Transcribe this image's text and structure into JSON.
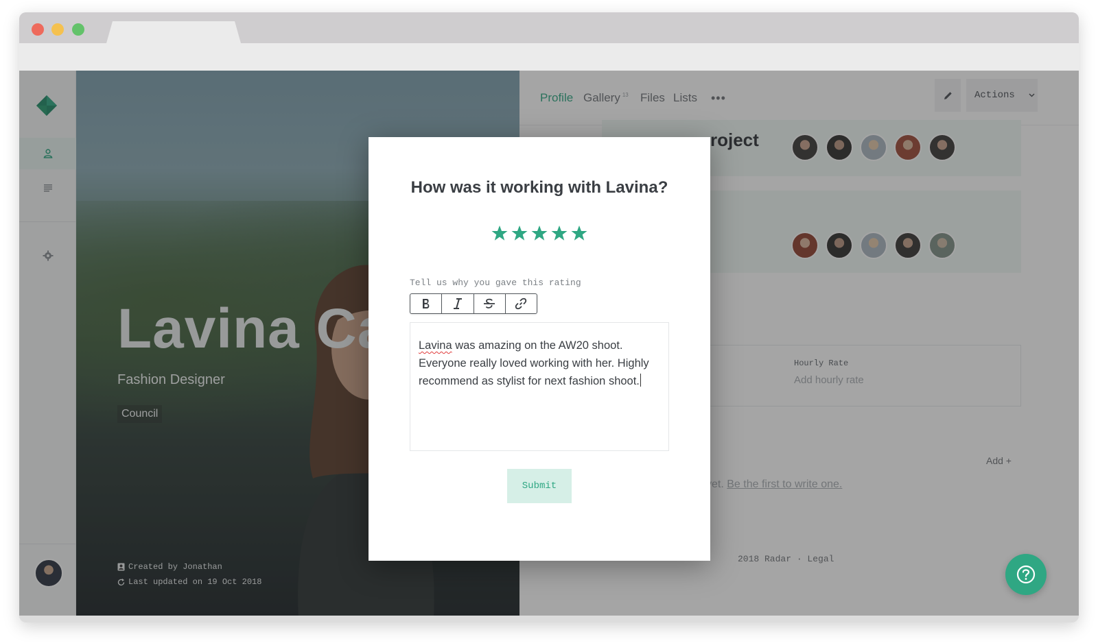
{
  "browser": {
    "window_controls": [
      "close",
      "minimize",
      "maximize"
    ],
    "tab_title": ""
  },
  "sidebar": {
    "logo_icon": "diamond-logo-icon",
    "items": [
      {
        "icon": "person-icon",
        "active": true
      },
      {
        "icon": "list-icon",
        "active": false
      },
      {
        "icon": "gear-icon",
        "active": false
      }
    ]
  },
  "hero": {
    "name": "Lavina Ca",
    "title": "Fashion Designer",
    "tag": "Council",
    "created_by": "Created by Jonathan",
    "last_updated": "Last updated on 19 Oct 2018"
  },
  "topnav": {
    "tabs": [
      {
        "label": "Profile",
        "active": true
      },
      {
        "label": "Gallery",
        "badge": "13",
        "active": false
      },
      {
        "label": "Files",
        "active": false
      },
      {
        "label": "Lists",
        "active": false
      }
    ],
    "more": "•••",
    "actions_label": "Actions"
  },
  "content": {
    "project_heading": "roject",
    "hourly_rate_label": "Hourly Rate",
    "hourly_rate_placeholder": "Add hourly rate",
    "add_label": "Add +",
    "reviews_prefix": "yet.",
    "reviews_link": "Be the first to write one.",
    "footer": "2018 Radar · Legal"
  },
  "modal": {
    "title": "How was it working with Lavina?",
    "rating": 5,
    "max_rating": 5,
    "field_label": "Tell us why you gave this rating",
    "editor_spell_word": "Lavina",
    "editor_text_rest": " was amazing on the AW20 shoot. Everyone really loved working with her. Highly recommend as stylist for next fashion shoot.",
    "toolbar": [
      "bold-icon",
      "italic-icon",
      "strikethrough-icon",
      "link-icon"
    ],
    "submit_label": "Submit"
  },
  "colors": {
    "accent": "#2fa783",
    "accent_light": "#d6efe7",
    "overlay": "rgba(40,40,40,0.42)"
  }
}
